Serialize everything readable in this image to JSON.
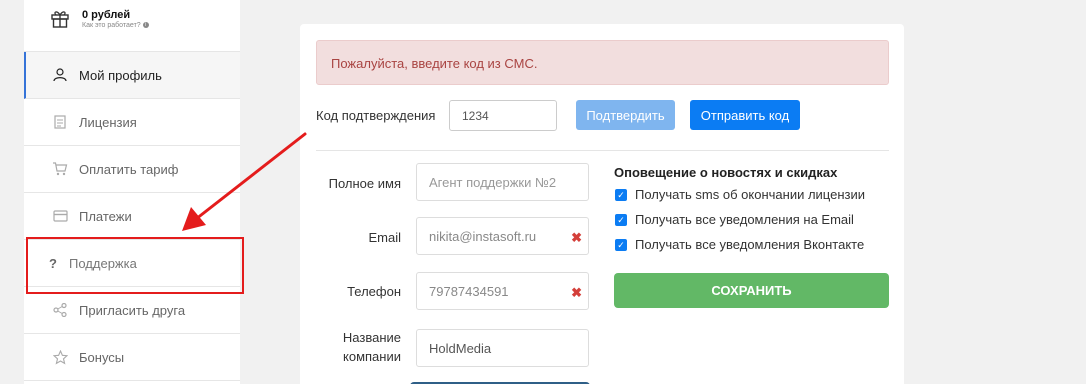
{
  "wallet": {
    "amount": "0 рублей",
    "how_it_works": "Как это работает?"
  },
  "sidebar": {
    "items": [
      {
        "label": "Мой профиль",
        "icon": "user-icon"
      },
      {
        "label": "Лицензия",
        "icon": "license-icon"
      },
      {
        "label": "Оплатить тариф",
        "icon": "cart-icon"
      },
      {
        "label": "Платежи",
        "icon": "card-icon"
      },
      {
        "label": "Поддержка",
        "icon": "question-icon"
      },
      {
        "label": "Пригласить друга",
        "icon": "share-icon"
      },
      {
        "label": "Бонусы",
        "icon": "star-icon"
      }
    ]
  },
  "alert": {
    "text": "Пожалуйста, введите код из СМС."
  },
  "confirm": {
    "label": "Код подтверждения",
    "value": "1234",
    "confirm_button": "Подтвердить",
    "send_button": "Отправить код"
  },
  "form": {
    "fullname": {
      "label": "Полное имя",
      "placeholder": "Агент поддержки №2"
    },
    "email": {
      "label": "Email",
      "value": "nikita@instasoft.ru"
    },
    "phone": {
      "label": "Телефон",
      "value": "79787434591"
    },
    "company": {
      "label": "Название компании",
      "value": "HoldMedia"
    }
  },
  "notifications": {
    "title": "Оповещение о новостях и скидках",
    "options": [
      {
        "label": "Получать sms об окончании лицензии",
        "checked": true
      },
      {
        "label": "Получать все уведомления на Email",
        "checked": true
      },
      {
        "label": "Получать все уведомления Вконтакте",
        "checked": true
      }
    ],
    "save_button": "СОХРАНИТЬ"
  },
  "colors": {
    "accent": "#0b7cf3",
    "save": "#62b866",
    "alert_bg": "#f2dede",
    "highlight": "#e41c1c"
  }
}
